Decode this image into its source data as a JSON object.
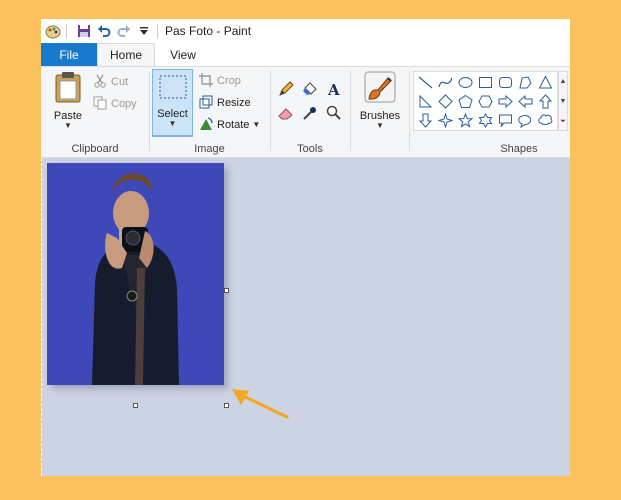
{
  "window": {
    "title": "Pas Foto - Paint"
  },
  "tabs": {
    "file": "File",
    "home": "Home",
    "view": "View"
  },
  "clipboard": {
    "paste": "Paste",
    "cut": "Cut",
    "copy": "Copy",
    "label": "Clipboard"
  },
  "image": {
    "select": "Select",
    "crop": "Crop",
    "resize": "Resize",
    "rotate": "Rotate",
    "label": "Image"
  },
  "tools": {
    "label": "Tools"
  },
  "brushes": {
    "label": "Brushes"
  },
  "shapes": {
    "label": "Shapes"
  },
  "colors": {
    "accent": "#1979ca",
    "canvas_bg": "#3f48b9",
    "workspace": "#ccd3e3",
    "page_bg": "#fbc15e",
    "arrow": "#f5a623"
  }
}
